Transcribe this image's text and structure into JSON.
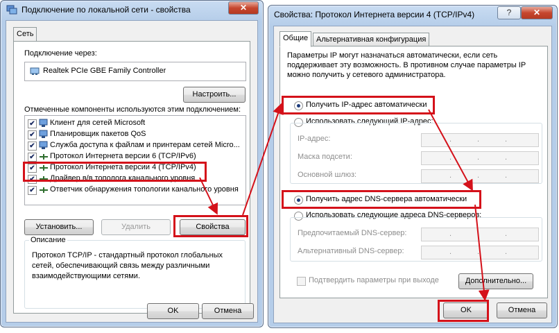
{
  "left_window": {
    "title": "Подключение по локальной сети - свойства",
    "close_glyph": "✕",
    "tab_label": "Сеть",
    "connect_via_label": "Подключение через:",
    "adapter_name": "Realtek PCIe GBE Family Controller",
    "configure_button": "Настроить...",
    "components_label": "Отмеченные компоненты используются этим подключением:",
    "components": [
      {
        "label": "Клиент для сетей Microsoft",
        "checked": true,
        "icon": "network-client-icon"
      },
      {
        "label": "Планировщик пакетов QoS",
        "checked": true,
        "icon": "network-service-icon"
      },
      {
        "label": "Служба доступа к файлам и принтерам сетей Micro...",
        "checked": true,
        "icon": "network-service-icon"
      },
      {
        "label": "Протокол Интернета версии 6 (TCP/IPv6)",
        "checked": true,
        "icon": "protocol-icon"
      },
      {
        "label": "Протокол Интернета версии 4 (TCP/IPv4)",
        "checked": true,
        "icon": "protocol-icon"
      },
      {
        "label": "Драйвер в/в тополога канального уровня",
        "checked": true,
        "icon": "protocol-icon"
      },
      {
        "label": "Ответчик обнаружения топологии канального уровня",
        "checked": true,
        "icon": "protocol-icon"
      }
    ],
    "install_button": "Установить...",
    "remove_button": "Удалить",
    "properties_button": "Свойства",
    "description_label": "Описание",
    "description_text": "Протокол TCP/IP - стандартный протокол глобальных сетей, обеспечивающий связь между различными взаимодействующими сетями.",
    "ok_button": "OK",
    "cancel_button": "Отмена"
  },
  "right_window": {
    "title": "Свойства: Протокол Интернета версии 4 (TCP/IPv4)",
    "help_glyph": "?",
    "close_glyph": "✕",
    "tabs": [
      "Общие",
      "Альтернативная конфигурация"
    ],
    "intro_text": "Параметры IP могут назначаться автоматически, если сеть поддерживает эту возможность. В противном случае параметры IP можно получить у сетевого администратора.",
    "ip_auto_label": "Получить IP-адрес автоматически",
    "ip_manual_label": "Использовать следующий IP-адрес:",
    "ip_address_label": "IP-адрес:",
    "subnet_label": "Маска подсети:",
    "gateway_label": "Основной шлюз:",
    "dns_auto_label": "Получить адрес DNS-сервера автоматически",
    "dns_manual_label": "Использовать следующие адреса DNS-серверов:",
    "preferred_dns_label": "Предпочитаемый DNS-сервер:",
    "alternate_dns_label": "Альтернативный DNS-сервер:",
    "validate_label": "Подтвердить параметры при выходе",
    "advanced_button": "Дополнительно...",
    "ok_button": "OK",
    "cancel_button": "Отмена",
    "ip_selected": "auto",
    "dns_selected": "auto"
  },
  "accent_colors": {
    "highlight": "#d4111a",
    "title_bar": "#b5cde9"
  }
}
